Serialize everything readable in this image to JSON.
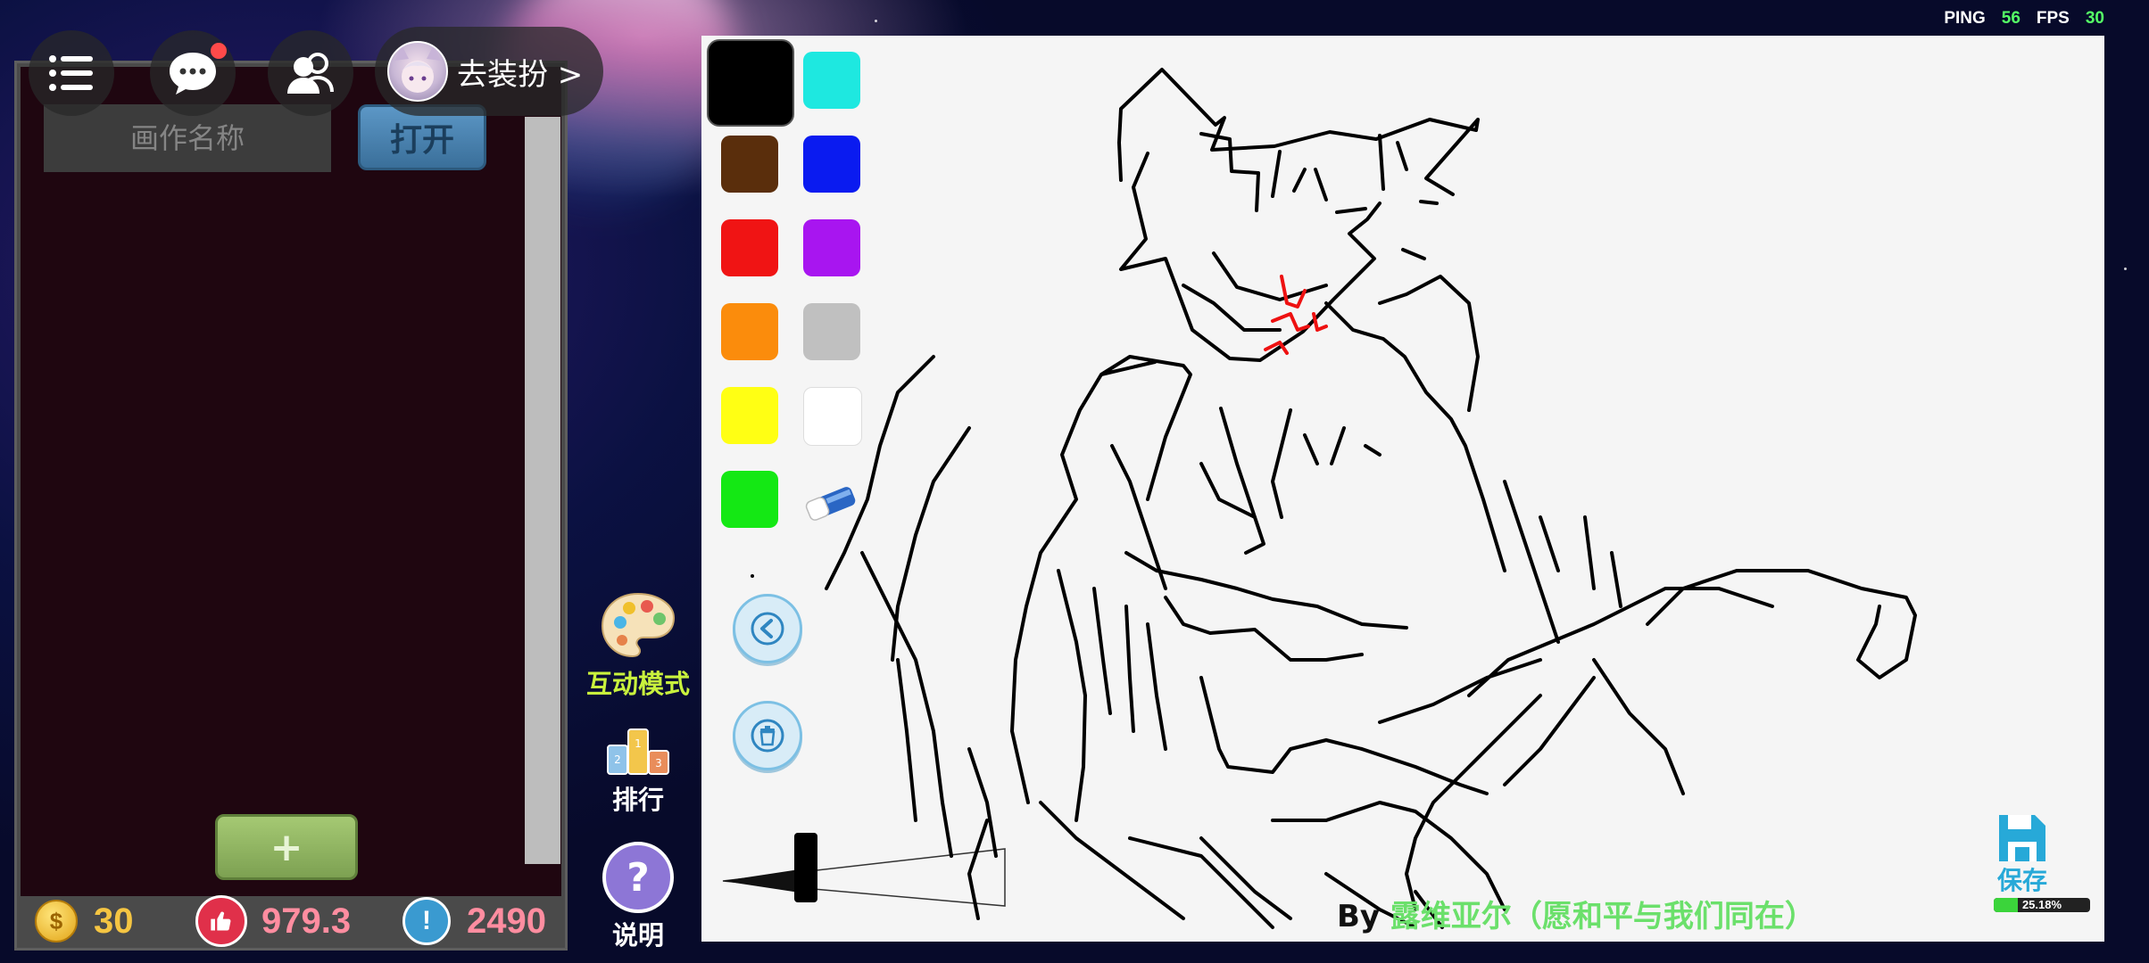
{
  "stats": {
    "ping_label": "PING",
    "ping_value": "56",
    "fps_label": "FPS",
    "fps_value": "30"
  },
  "top_bar": {
    "menu_icon": "list-icon",
    "chat_icon": "chat-bubble-icon",
    "friends_icon": "friends-icon",
    "dress_up_label": "去装扮 >"
  },
  "left_panel": {
    "name_placeholder": "画作名称",
    "open_label": "打开",
    "add_label": "+",
    "coin_icon": "$",
    "coins": "30",
    "likes": "979.3",
    "warn_icon": "!",
    "reports": "2490"
  },
  "middle": {
    "interactive_label": "互动模式",
    "rank_label": "排行",
    "help_label": "说明",
    "help_icon": "?"
  },
  "palette": {
    "colors": [
      "#000000",
      "#1ee8e0",
      "#5a2e0c",
      "#0a1bf0",
      "#f01414",
      "#a815f0",
      "#fb8c0c",
      "#c0c0c0",
      "#ffff14",
      "#ffffff",
      "#14e814"
    ],
    "selected": "#000000"
  },
  "canvas": {
    "credit_by": "By",
    "credit_author": "露维亚尔（愿和平与我们同在）"
  },
  "save": {
    "label": "保存",
    "progress_text": "25.18%",
    "progress": 0.2518
  },
  "accent": {
    "interactive": "#c9f23d",
    "save": "#27a9d8",
    "credit": "#6be06b"
  }
}
